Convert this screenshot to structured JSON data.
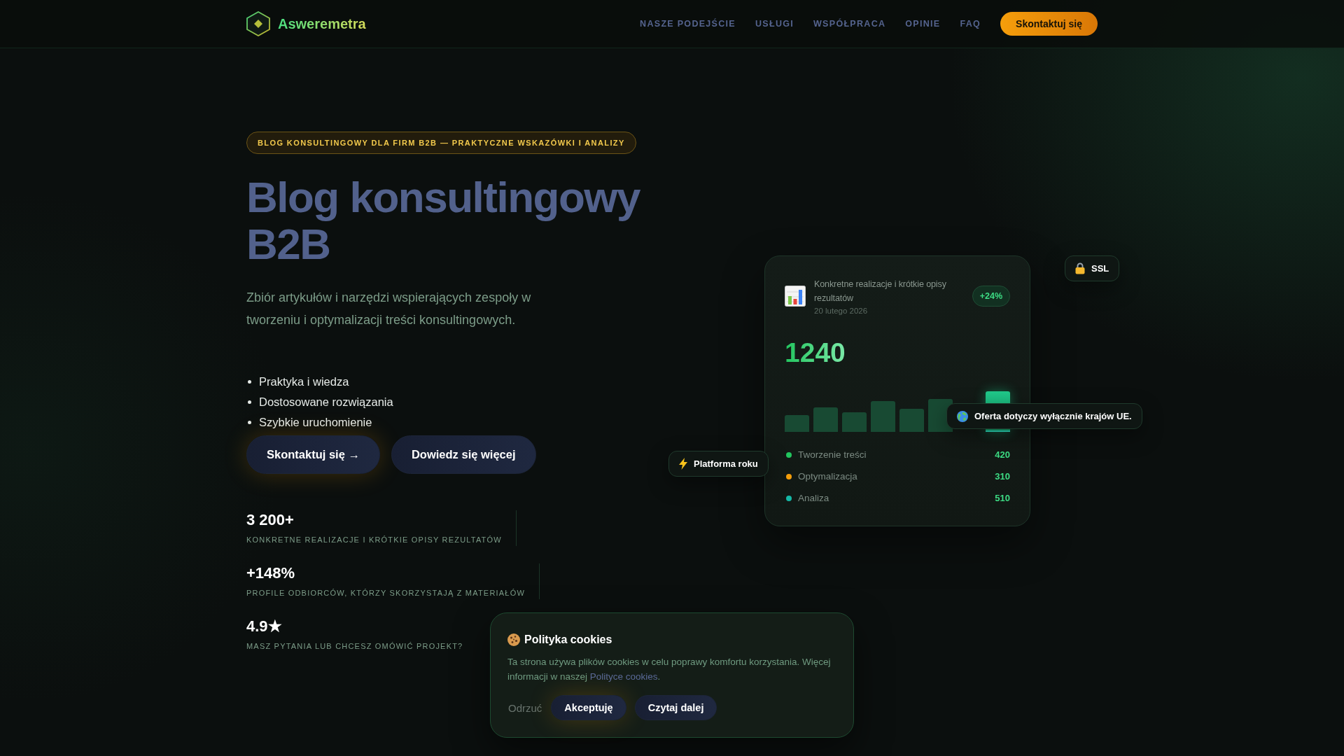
{
  "header": {
    "brand": "Asweremetra",
    "nav": [
      "NASZE PODEJŚCIE",
      "USŁUGI",
      "WSPÓŁPRACA",
      "OPINIE",
      "FAQ"
    ],
    "cta": "Skontaktuj się"
  },
  "hero": {
    "badge": "BLOG KONSULTINGOWY DLA FIRM B2B — PRAKTYCZNE WSKAZÓWKI I ANALIZY",
    "title": "Blog konsultingowy B2B",
    "subtitle": "Zbiór artykułów i narzędzi wspierających zespoły w tworzeniu i optymalizacji treści konsultingowych.",
    "features": [
      "Praktyka i wiedza",
      "Dostosowane rozwiązania",
      "Szybkie uruchomienie"
    ],
    "buttons": [
      {
        "label": "Skontaktuj się →",
        "kind": "primary"
      },
      {
        "label": "Dowiedz się więcej",
        "kind": "secondary"
      }
    ]
  },
  "stats": [
    {
      "value": "3 200+",
      "label": "KONKRETNE REALIZACJE I KRÓTKIE OPISY REZULTATÓW"
    },
    {
      "value": "+148%",
      "label": "PROFILE ODBIORCÓW, KTÓRZY SKORZYSTAJĄ Z MATERIAŁÓW"
    },
    {
      "value": "4.9★",
      "label": "MASZ PYTANIA LUB CHCESZ OMÓWIĆ PROJEKT?"
    }
  ],
  "card": {
    "title": "Konkretne realizacje i krótkie opisy rezultatów",
    "date": "20 lutego 2026",
    "badge": "+24%",
    "total": "1240",
    "legend": [
      {
        "label": "Tworzenie treści",
        "value": "420",
        "color": "#22c55e"
      },
      {
        "label": "Optymalizacja",
        "value": "310",
        "color": "#f59e0b"
      },
      {
        "label": "Analiza",
        "value": "510",
        "color": "#14b8a6"
      }
    ]
  },
  "chips": [
    {
      "kind": "ssl",
      "label": "SSL"
    },
    {
      "kind": "region",
      "label": "Oferta dotyczy wyłącznie krajów UE."
    },
    {
      "kind": "award",
      "label": "Platforma roku"
    }
  ],
  "cookie_banner": {
    "title": "Polityka cookies",
    "text": "Ta strona używa plików cookies w celu poprawy komfortu korzystania. Więcej informacji w naszej ",
    "link": "Polityce cookies",
    "text_end": ".",
    "buttons": [
      {
        "label": "Odrzuć",
        "kind": "text"
      },
      {
        "label": "Akceptuję",
        "kind": "primary"
      },
      {
        "label": "Czytaj dalej",
        "kind": "secondary"
      }
    ]
  }
}
